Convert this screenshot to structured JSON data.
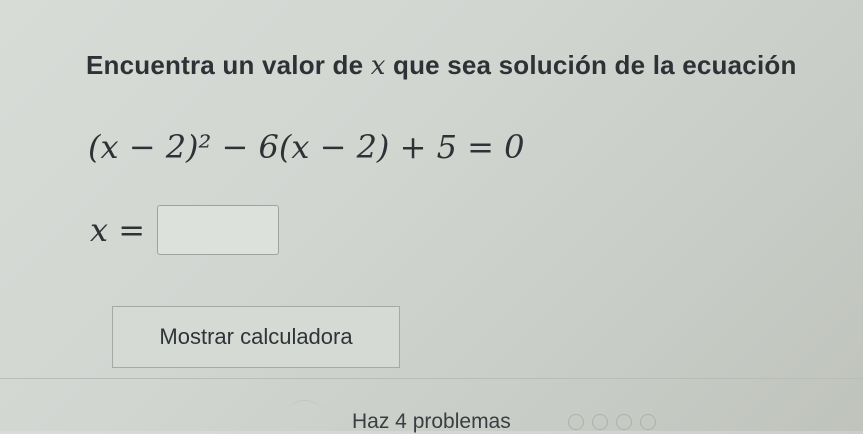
{
  "question": {
    "text_before": "Encuentra un valor de ",
    "variable": "x",
    "text_after": " que sea solución de la ecuación"
  },
  "equation": {
    "text": "(x − 2)² − 6(x − 2) + 5 = 0"
  },
  "answer": {
    "label": "x =",
    "value": ""
  },
  "calculator_button": {
    "label": "Mostrar calculadora"
  },
  "footer": {
    "problems_remaining": "Haz 4 problemas"
  },
  "progress": {
    "total_dots": 4,
    "completed": 0
  }
}
